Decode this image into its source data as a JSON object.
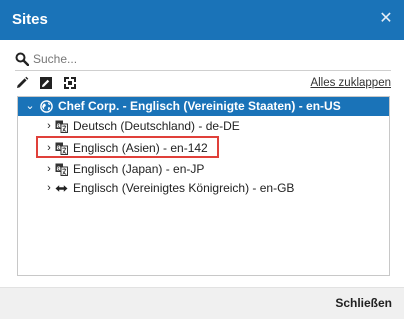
{
  "dialog": {
    "title": "Sites",
    "close_icon": "close-icon",
    "accent_color": "#1a73b8",
    "highlight_color": "#e0403a"
  },
  "search": {
    "placeholder": "Suche...",
    "value": "",
    "icon": "search-icon"
  },
  "toolbar": {
    "tools": [
      {
        "icon": "pencil-icon"
      },
      {
        "icon": "edit-box-icon"
      },
      {
        "icon": "expand-icon"
      }
    ],
    "collapse_all_label": "Alles zuklappen"
  },
  "tree": {
    "root": {
      "label": "Chef Corp. - Englisch (Vereinigte Staaten) - en-US",
      "icon": "globe-icon",
      "expanded": true,
      "selected": true
    },
    "children": [
      {
        "label": "Deutsch (Deutschland) - de-DE",
        "icon": "translate-icon"
      },
      {
        "label": "Englisch (Asien) - en-142",
        "icon": "translate-icon",
        "highlighted": true
      },
      {
        "label": "Englisch (Japan) - en-JP",
        "icon": "translate-icon"
      },
      {
        "label": "Englisch (Vereinigtes Königreich) - en-GB",
        "icon": "sync-arrows-icon"
      }
    ]
  },
  "footer": {
    "close_label": "Schließen"
  }
}
